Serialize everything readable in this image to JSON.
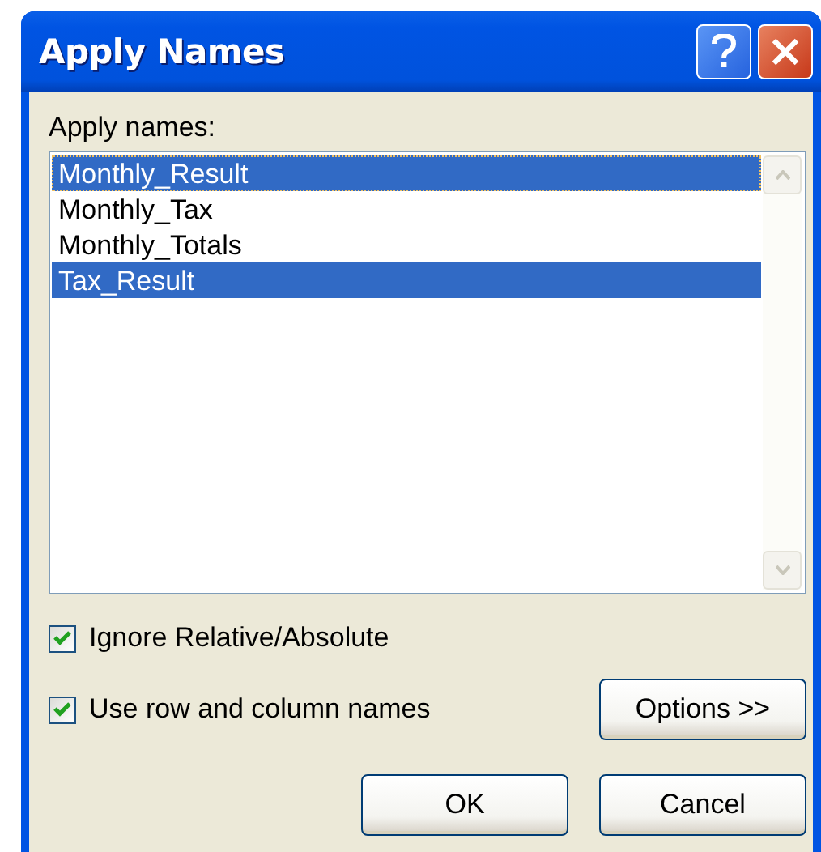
{
  "window": {
    "title": "Apply Names"
  },
  "list": {
    "label": "Apply names:",
    "items": [
      {
        "name": "Monthly_Result",
        "selected": true,
        "focused": true
      },
      {
        "name": "Monthly_Tax",
        "selected": false,
        "focused": false
      },
      {
        "name": "Monthly_Totals",
        "selected": false,
        "focused": false
      },
      {
        "name": "Tax_Result",
        "selected": true,
        "focused": false
      }
    ]
  },
  "checkboxes": [
    {
      "label": "Ignore Relative/Absolute",
      "checked": true
    },
    {
      "label": "Use row and column names",
      "checked": true
    }
  ],
  "buttons": [
    {
      "label": "Options >>",
      "kind": "options"
    },
    {
      "label": "OK",
      "kind": "ok"
    },
    {
      "label": "Cancel",
      "kind": "cancel"
    }
  ]
}
